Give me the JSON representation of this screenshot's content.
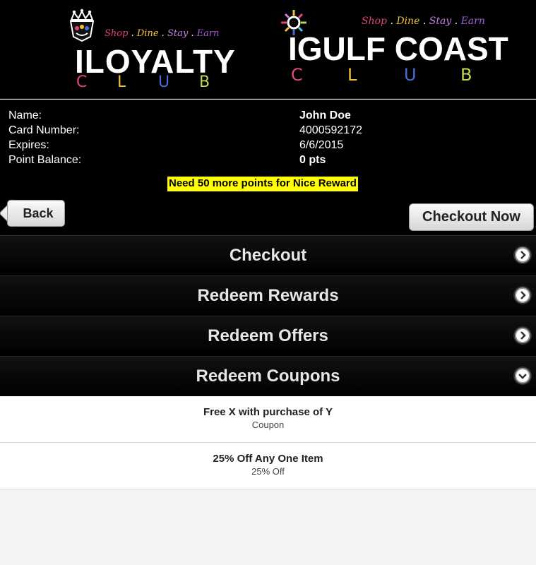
{
  "header": {
    "left_logo": {
      "tagline": [
        "Shop",
        ".",
        "Dine",
        ".",
        "Stay",
        ".",
        "Earn"
      ],
      "wordmark": "ILOYALTY",
      "club_letters": [
        "C",
        "L",
        "U",
        "B"
      ]
    },
    "right_logo": {
      "tagline": [
        "Shop",
        ".",
        "Dine",
        ".",
        "Stay",
        ".",
        "Earn"
      ],
      "wordmark": "IGULF COAST",
      "club_letters": [
        "C",
        "L",
        "U",
        "B"
      ]
    }
  },
  "account": {
    "name_label": "Name:",
    "name_value": "John Doe",
    "card_label": "Card Number:",
    "card_value": "4000592172",
    "expires_label": "Expires:",
    "expires_value": "6/6/2015",
    "balance_label": "Point Balance:",
    "balance_value": "0 pts"
  },
  "notice": "Need 50 more points for Nice Reward",
  "buttons": {
    "back": "Back",
    "checkout_now": "Checkout Now"
  },
  "menu": [
    {
      "label": "Checkout",
      "icon": "arrow-right-circle-icon"
    },
    {
      "label": "Redeem Rewards",
      "icon": "arrow-right-circle-icon"
    },
    {
      "label": "Redeem Offers",
      "icon": "arrow-right-circle-icon"
    },
    {
      "label": "Redeem Coupons",
      "icon": "chevron-down-circle-icon"
    }
  ],
  "coupons": [
    {
      "title": "Free X with purchase of Y",
      "subtitle": "Coupon"
    },
    {
      "title": "25% Off Any One Item",
      "subtitle": "25% Off"
    }
  ],
  "colors": {
    "notice_bg": "#ffff00",
    "header_bg": "#000000",
    "club_c": "#e0457b",
    "club_l": "#f1c232",
    "club_u": "#4b6bd8",
    "club_b": "#c2d64a"
  }
}
